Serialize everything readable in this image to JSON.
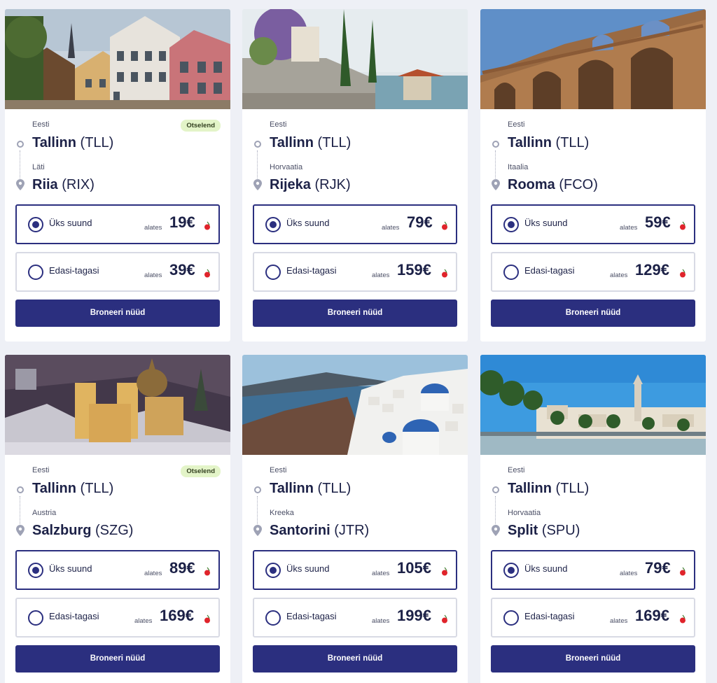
{
  "cards": [
    {
      "from_country": "Eesti",
      "from_city": "Tallinn",
      "from_code": "(TLL)",
      "to_country": "Läti",
      "to_city": "Riia",
      "to_code": "(RIX)",
      "badge": "Otselend",
      "one_way_label": "Üks suund",
      "one_way_prefix": "alates",
      "one_way_price": "19€",
      "round_trip_label": "Edasi-tagasi",
      "round_trip_prefix": "alates",
      "round_trip_price": "39€",
      "book_label": "Broneeri nüüd",
      "photo": "riga-old-town-photo"
    },
    {
      "from_country": "Eesti",
      "from_city": "Tallinn",
      "from_code": "(TLL)",
      "to_country": "Horvaatia",
      "to_city": "Rijeka",
      "to_code": "(RJK)",
      "badge": "",
      "one_way_label": "Üks suund",
      "one_way_prefix": "alates",
      "one_way_price": "79€",
      "round_trip_label": "Edasi-tagasi",
      "round_trip_prefix": "alates",
      "round_trip_price": "159€",
      "book_label": "Broneeri nüüd",
      "photo": "rijeka-coast-photo"
    },
    {
      "from_country": "Eesti",
      "from_city": "Tallinn",
      "from_code": "(TLL)",
      "to_country": "Itaalia",
      "to_city": "Rooma",
      "to_code": "(FCO)",
      "badge": "",
      "one_way_label": "Üks suund",
      "one_way_prefix": "alates",
      "one_way_price": "59€",
      "round_trip_label": "Edasi-tagasi",
      "round_trip_prefix": "alates",
      "round_trip_price": "129€",
      "book_label": "Broneeri nüüd",
      "photo": "rome-colosseum-photo"
    },
    {
      "from_country": "Eesti",
      "from_city": "Tallinn",
      "from_code": "(TLL)",
      "to_country": "Austria",
      "to_city": "Salzburg",
      "to_code": "(SZG)",
      "badge": "Otselend",
      "one_way_label": "Üks suund",
      "one_way_prefix": "alates",
      "one_way_price": "89€",
      "round_trip_label": "Edasi-tagasi",
      "round_trip_prefix": "alates",
      "round_trip_price": "169€",
      "book_label": "Broneeri nüüd",
      "photo": "salzburg-winter-photo"
    },
    {
      "from_country": "Eesti",
      "from_city": "Tallinn",
      "from_code": "(TLL)",
      "to_country": "Kreeka",
      "to_city": "Santorini",
      "to_code": "(JTR)",
      "badge": "",
      "one_way_label": "Üks suund",
      "one_way_prefix": "alates",
      "one_way_price": "105€",
      "round_trip_label": "Edasi-tagasi",
      "round_trip_prefix": "alates",
      "round_trip_price": "199€",
      "book_label": "Broneeri nüüd",
      "photo": "santorini-photo"
    },
    {
      "from_country": "Eesti",
      "from_city": "Tallinn",
      "from_code": "(TLL)",
      "to_country": "Horvaatia",
      "to_city": "Split",
      "to_code": "(SPU)",
      "badge": "",
      "one_way_label": "Üks suund",
      "one_way_prefix": "alates",
      "one_way_price": "79€",
      "round_trip_label": "Edasi-tagasi",
      "round_trip_prefix": "alates",
      "round_trip_price": "169€",
      "book_label": "Broneeri nüüd",
      "photo": "split-harbour-photo"
    }
  ],
  "colors": {
    "primary": "#2b2f7f",
    "badge_bg": "#e3f4c8",
    "background": "#eef0f6",
    "cherry": "#e0242b"
  }
}
